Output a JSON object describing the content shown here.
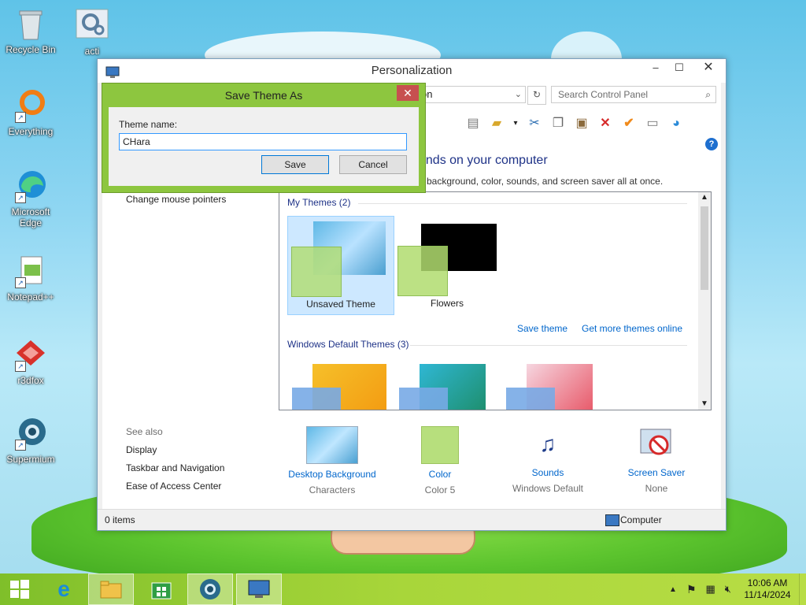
{
  "desktop": {
    "icons": [
      {
        "label": "Recycle Bin"
      },
      {
        "label": "acti"
      },
      {
        "label": "Everything"
      },
      {
        "label": "Microsoft Edge"
      },
      {
        "label": "Notepad++"
      },
      {
        "label": "r3dfox"
      },
      {
        "label": "Supermium"
      }
    ]
  },
  "window": {
    "title": "Personalization",
    "address_partial": "on",
    "search_placeholder": "Search Control Panel",
    "heading_partial": "unds on your computer",
    "subheading_partial": "p background, color, sounds, and screen saver all at once.",
    "left_link": "Change mouse pointers",
    "my_themes_title": "My Themes (2)",
    "themes": [
      {
        "label": "Unsaved Theme"
      },
      {
        "label": "Flowers"
      }
    ],
    "save_theme_link": "Save theme",
    "get_more_link": "Get more themes online",
    "default_themes_title": "Windows Default Themes (3)",
    "see_also": {
      "title": "See also",
      "links": [
        "Display",
        "Taskbar and Navigation",
        "Ease of Access Center"
      ]
    },
    "bottom": [
      {
        "label": "Desktop Background",
        "value": "Characters"
      },
      {
        "label": "Color",
        "value": "Color 5"
      },
      {
        "label": "Sounds",
        "value": "Windows Default"
      },
      {
        "label": "Screen Saver",
        "value": "None"
      }
    ],
    "status_items": "0 items",
    "status_computer": "Computer"
  },
  "dialog": {
    "title": "Save Theme As",
    "close": "✕",
    "field_label": "Theme name:",
    "field_value": "CHara",
    "save": "Save",
    "cancel": "Cancel"
  },
  "taskbar": {
    "time": "10:06 AM",
    "date": "11/14/2024"
  },
  "colors": {
    "dialog_frame": "#8dc63f",
    "link": "#0066cc",
    "heading": "#1e3287"
  }
}
